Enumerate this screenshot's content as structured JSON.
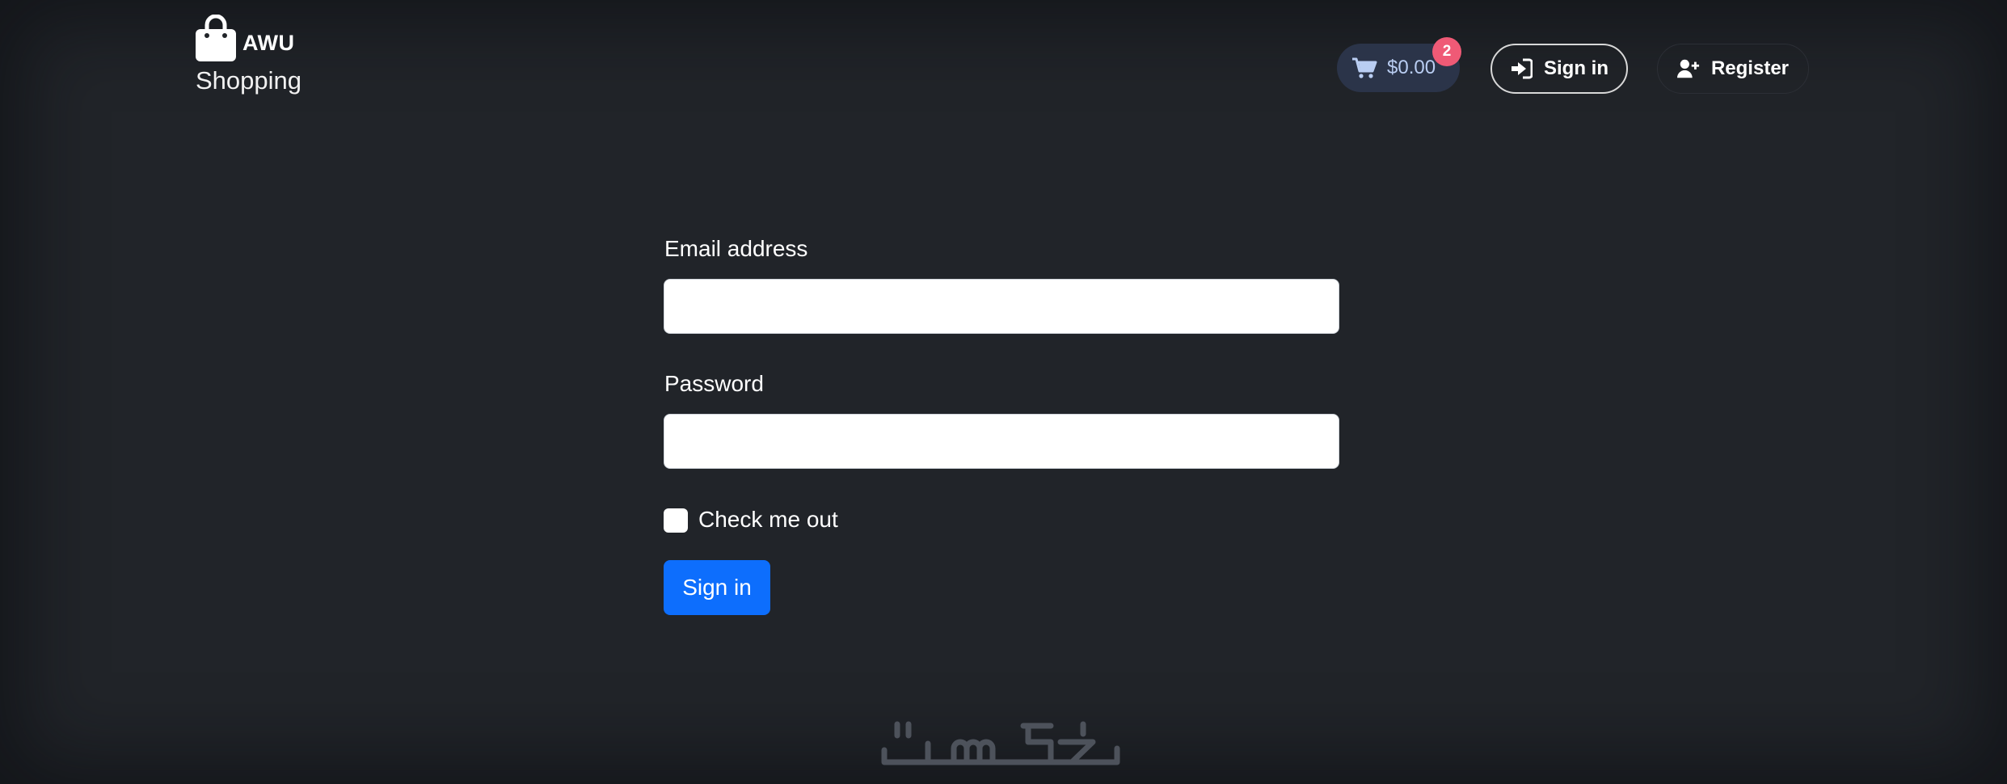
{
  "header": {
    "brand_name": "AWU",
    "brand_sub": "Shopping",
    "cart": {
      "label": "$0.00",
      "count": "2"
    },
    "signin_label": "Sign in",
    "register_label": "Register"
  },
  "form": {
    "email_label": "Email address",
    "email_value": "",
    "password_label": "Password",
    "password_value": "",
    "checkbox_label": "Check me out",
    "checkbox_checked": false,
    "submit_label": "Sign in"
  },
  "watermark": {
    "text": "خمسات"
  },
  "icons": {
    "brand": "shopping-bag-icon",
    "cart": "cart-icon",
    "signin": "sign-in-icon",
    "register": "user-plus-icon"
  },
  "colors": {
    "background": "#212429",
    "primary": "#0d6efd",
    "badge": "#ef5a76",
    "cart_pill": "#2b3449",
    "cart_text": "#b9cdf2"
  }
}
